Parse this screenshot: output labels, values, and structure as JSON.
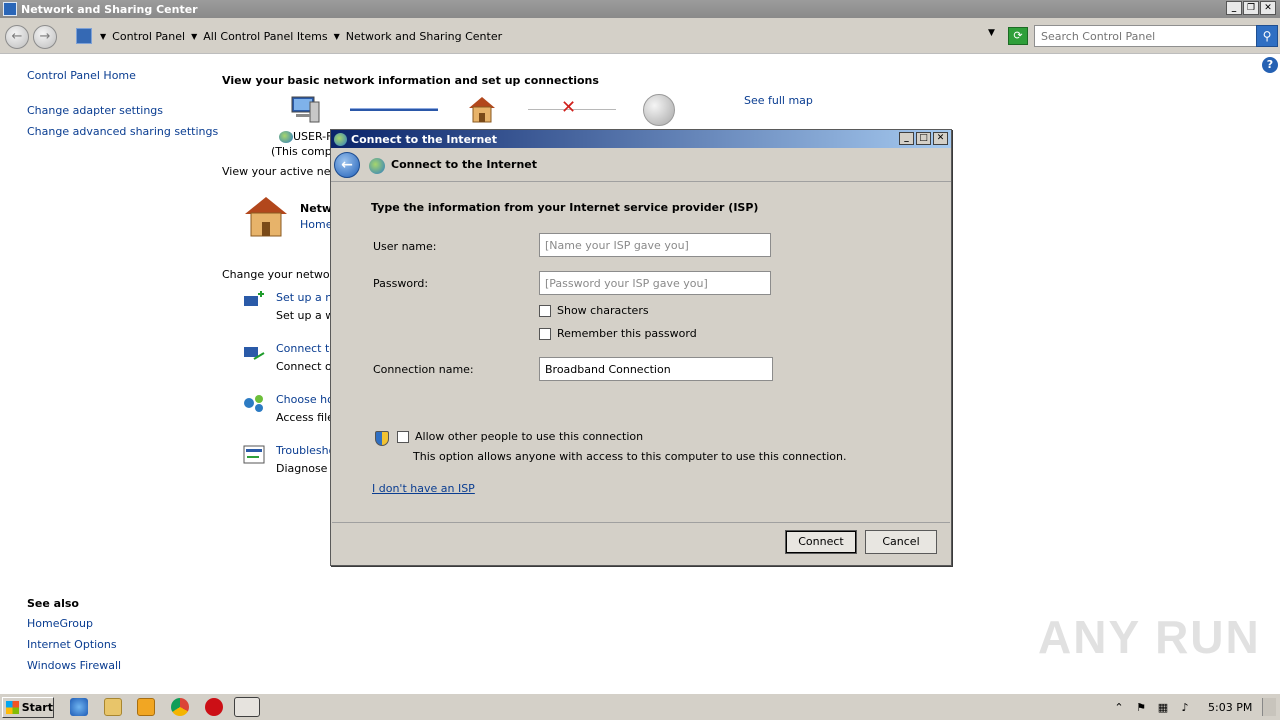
{
  "window": {
    "title": "Network and Sharing Center"
  },
  "address": {
    "breadcrumbs": [
      "Control Panel",
      "All Control Panel Items",
      "Network and Sharing Center"
    ],
    "search_placeholder": "Search Control Panel"
  },
  "left_pane": {
    "items": [
      "Control Panel Home",
      "Change adapter settings",
      "Change advanced sharing settings"
    ],
    "see_also_title": "See also",
    "see_also": [
      "HomeGroup",
      "Internet Options",
      "Windows Firewall"
    ]
  },
  "main": {
    "heading": "View your basic network information and set up connections",
    "see_full_map": "See full map",
    "computer_name": "USER-F",
    "computer_sub": "(This compu",
    "active_networks": "View your active netw",
    "network_name": "Netw",
    "network_type": "Home",
    "change_settings": "Change your networki",
    "tasks": [
      {
        "title": "Set up a ne",
        "desc": "Set up a wi"
      },
      {
        "title": "Connect to",
        "desc": "Connect or"
      },
      {
        "title": "Choose hor",
        "desc": "Access files"
      },
      {
        "title": "Troublesho",
        "desc": "Diagnose a"
      }
    ]
  },
  "dialog": {
    "title": "Connect to the Internet",
    "header": "Connect to the Internet",
    "heading": "Type the information from your Internet service provider (ISP)",
    "username_label": "User name:",
    "username_placeholder": "[Name your ISP gave you]",
    "password_label": "Password:",
    "password_placeholder": "[Password your ISP gave you]",
    "show_characters": "Show characters",
    "remember_password": "Remember this password",
    "connection_name_label": "Connection name:",
    "connection_name_value": "Broadband Connection",
    "allow_others": "Allow other people to use this connection",
    "allow_others_desc": "This option allows anyone with access to this computer to use this connection.",
    "no_isp_link": "I don't have an ISP",
    "connect_button": "Connect",
    "cancel_button": "Cancel"
  },
  "watermark": "ANY RUN",
  "taskbar": {
    "start_label": "Start",
    "clock": "5:03 PM"
  }
}
